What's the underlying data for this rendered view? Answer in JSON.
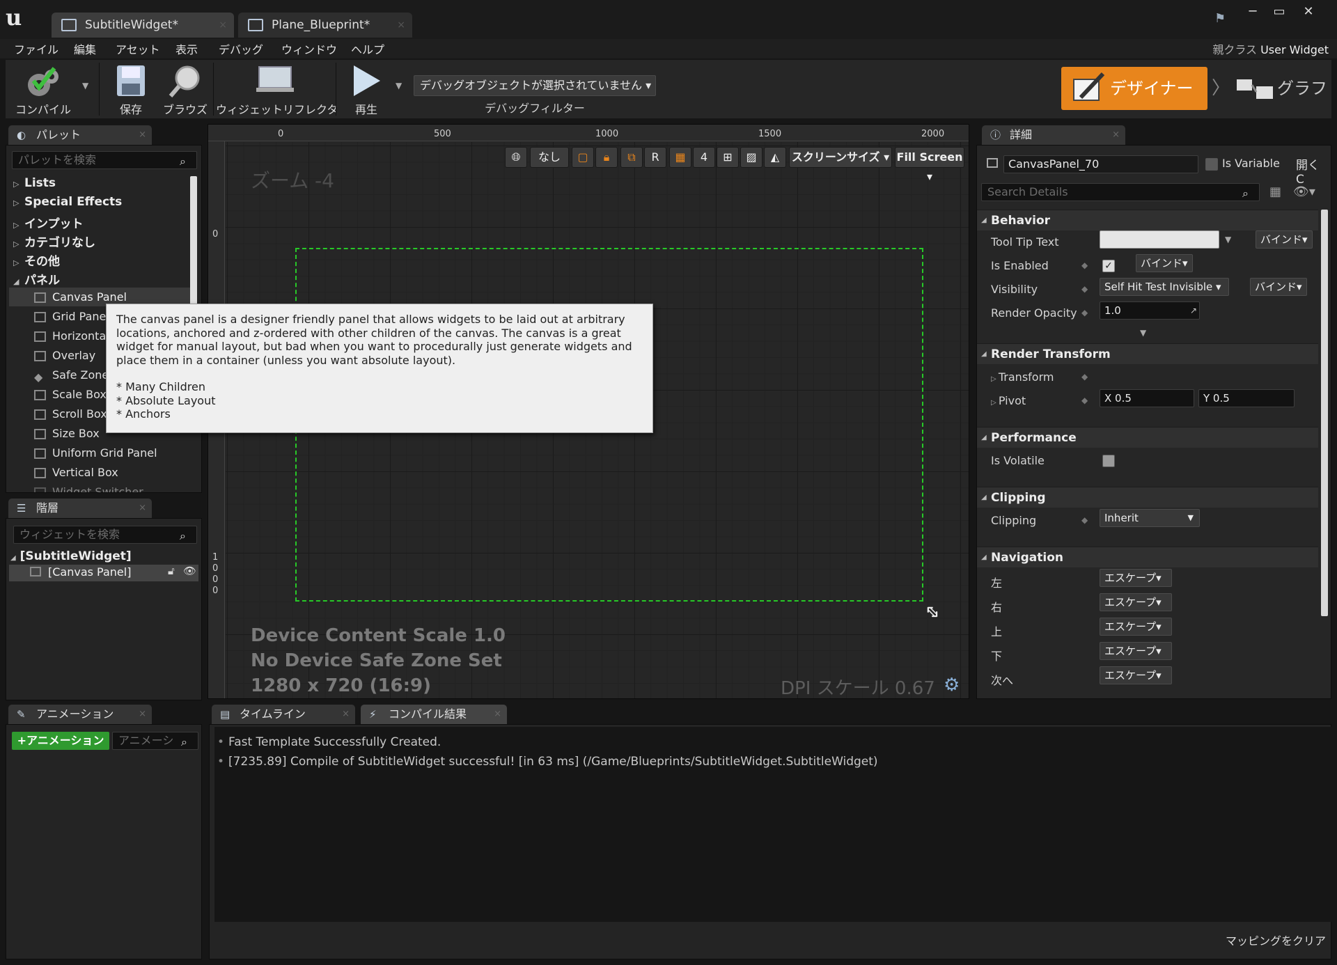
{
  "app": {
    "tabs": [
      {
        "label": "SubtitleWidget*",
        "active": true
      },
      {
        "label": "Plane_Blueprint*",
        "active": false
      }
    ],
    "window_controls": {
      "minimize": "─",
      "maximize": "▭",
      "close": "✕"
    }
  },
  "menu": {
    "items": [
      "ファイル",
      "編集",
      "アセット",
      "表示",
      "デバッグ",
      "ウィンドウ",
      "ヘルプ"
    ],
    "parent_class_label": "親クラス",
    "parent_class_value": "User Widget"
  },
  "toolbar": {
    "compile": "コンパイル",
    "save": "保存",
    "browse": "ブラウズ",
    "widget_reflector": "ウィジェットリフレクタ",
    "play": "再生",
    "debug_object": "デバッグオブジェクトが選択されていません ▾",
    "debug_filter": "デバッグフィルター",
    "designer": "デザイナー",
    "graph": "グラフ"
  },
  "palette": {
    "title": "パレット",
    "search_placeholder": "パレットを検索",
    "categories": [
      "Lists",
      "Special Effects",
      "インプット",
      "カテゴリなし",
      "その他",
      "パネル"
    ],
    "panel_items": [
      "Canvas Panel",
      "Grid Panel",
      "Horizontal",
      "Overlay",
      "Safe Zone",
      "Scale Box",
      "Scroll Box",
      "Size Box",
      "Uniform Grid Panel",
      "Vertical Box",
      "Widget Switcher"
    ]
  },
  "tooltip": {
    "text": "The canvas panel is a designer friendly panel that allows widgets to be laid out at arbitrary locations, anchored and z-ordered with other children of the canvas.  The canvas is a great widget for manual layout, but bad when you want to procedurally just generate widgets and place them in a container (unless you want absolute layout).",
    "bullets": [
      "* Many Children",
      "* Absolute Layout",
      "* Anchors"
    ]
  },
  "hierarchy": {
    "title": "階層",
    "search_placeholder": "ウィジェットを検索",
    "root": "[SubtitleWidget]",
    "child": "[Canvas Panel]"
  },
  "animation": {
    "title": "アニメーション",
    "add_button": "+アニメーション",
    "search_placeholder": "アニメーシ"
  },
  "designer": {
    "zoom": "ズーム -4",
    "ruler_top": [
      "0",
      "500",
      "1000",
      "1500",
      "2000"
    ],
    "ruler_left": [
      "0",
      "1",
      "0",
      "0",
      "0"
    ],
    "toolbar": {
      "none": "なし",
      "r": "R",
      "grid_value": "4",
      "screen_size": "スクリーンサイズ ▾",
      "fill_screen": "Fill Screen ▾"
    },
    "device_content_scale": "Device Content Scale 1.0",
    "safe_zone": "No Device Safe Zone Set",
    "resolution": "1280 x 720 (16:9)",
    "dpi_scale": "DPI スケール 0.67"
  },
  "bottom_tabs": {
    "timeline": "タイムライン",
    "compile_results": "コンパイル結果"
  },
  "log": [
    "Fast Template Successfully Created.",
    "[7235.89] Compile of SubtitleWidget successful! [in 63 ms] (/Game/Blueprints/SubtitleWidget.SubtitleWidget)"
  ],
  "clear_mapping": "マッピングをクリア",
  "details": {
    "title": "詳細",
    "widget_name": "CanvasPanel_70",
    "is_variable": "Is Variable",
    "open_label": "開く C",
    "search_placeholder": "Search Details",
    "behavior": "Behavior",
    "tool_tip_text": "Tool Tip Text",
    "bind": "バインド▾",
    "is_enabled": "Is Enabled",
    "visibility": "Visibility",
    "visibility_value": "Self Hit Test Invisible ▾",
    "render_opacity": "Render Opacity",
    "render_opacity_value": "1.0",
    "render_transform": "Render Transform",
    "transform": "Transform",
    "pivot": "Pivot",
    "pivot_x": "X  0.5",
    "pivot_y": "Y  0.5",
    "performance": "Performance",
    "is_volatile": "Is Volatile",
    "clipping_section": "Clipping",
    "clipping": "Clipping",
    "clipping_value": "Inherit",
    "navigation": "Navigation",
    "nav_left": "左",
    "nav_right": "右",
    "nav_up": "上",
    "nav_down": "下",
    "nav_next": "次へ",
    "escape": "エスケープ▾"
  },
  "colors": {
    "accent": "#e8851c",
    "canvas_border": "#27c927"
  }
}
